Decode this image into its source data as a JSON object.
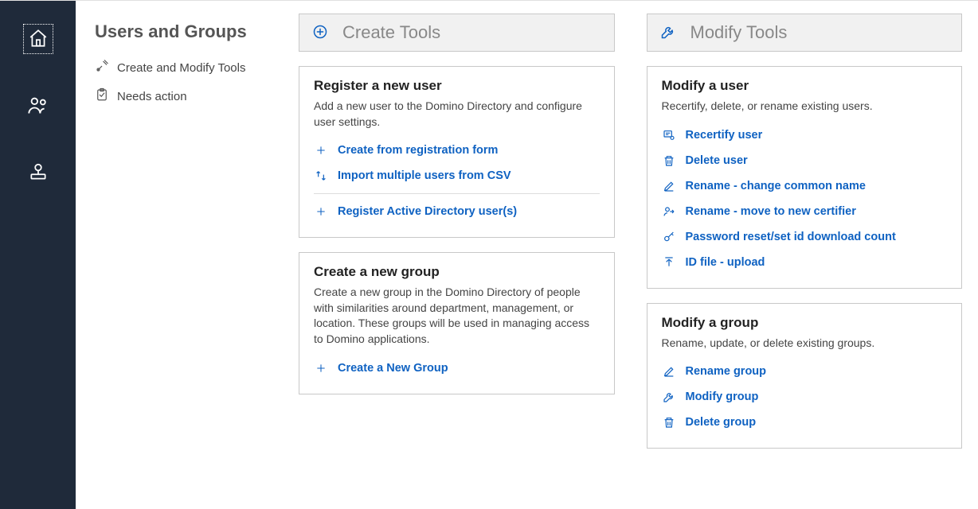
{
  "rail": {
    "home": "Home",
    "users": "Users and Groups",
    "apps": "Applications"
  },
  "sectionNav": {
    "title": "Users and Groups",
    "items": [
      {
        "label": "Create and Modify Tools"
      },
      {
        "label": "Needs action"
      }
    ]
  },
  "createTools": {
    "header": "Create Tools",
    "registerUser": {
      "title": "Register a new user",
      "desc": "Add a new user to the Domino Directory and configure user settings.",
      "fromForm": "Create from registration form",
      "importCsv": "Import multiple users from CSV",
      "registerAD": "Register Active Directory user(s)"
    },
    "createGroup": {
      "title": "Create a new group",
      "desc": "Create a new group in the Domino Directory of people with similarities around department, management, or location.  These groups will be used in managing access to Domino applications.",
      "createNewGroup": "Create a New Group"
    }
  },
  "modifyTools": {
    "header": "Modify Tools",
    "modifyUser": {
      "title": "Modify a user",
      "desc": "Recertify, delete, or rename existing users.",
      "recertify": "Recertify user",
      "deleteUser": "Delete user",
      "renameCommon": "Rename - change common name",
      "renameMove": "Rename - move to new certifier",
      "pwReset": "Password reset/set id download count",
      "idUpload": "ID file - upload"
    },
    "modifyGroup": {
      "title": "Modify a group",
      "desc": "Rename, update, or delete existing groups.",
      "renameGroup": "Rename group",
      "modifyGroup": "Modify group",
      "deleteGroup": "Delete group"
    }
  }
}
